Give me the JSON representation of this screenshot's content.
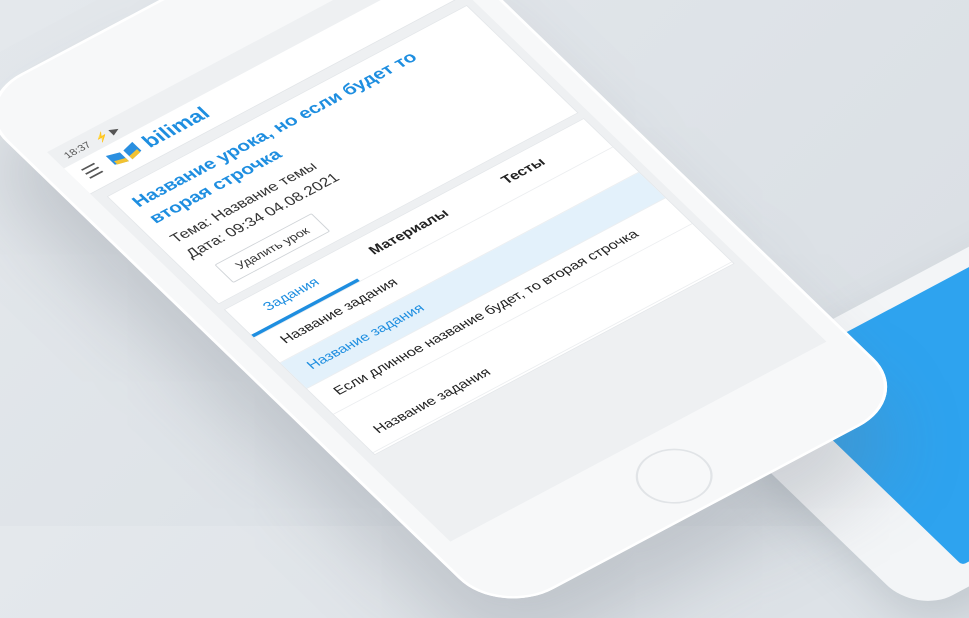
{
  "status_bar": {
    "time": "18:37",
    "icons": "⚡ ▶"
  },
  "app": {
    "brand": "bilimal",
    "menu_icon": "hamburger-icon"
  },
  "lesson": {
    "title": "Название урока, но если будет то вторая строчка",
    "topic": "Тема: Название темы",
    "date": "Дата: 09:34 04.08.2021",
    "delete_label": "Удалить урок"
  },
  "tabs": [
    {
      "label": "Задания"
    },
    {
      "label": "Материалы"
    },
    {
      "label": "Тесты"
    }
  ],
  "tasks": [
    {
      "label": "Название задания"
    },
    {
      "label": "Название задания"
    },
    {
      "label": "Если длинное название будет, то вторая строчка"
    },
    {
      "label": "Название задания"
    }
  ],
  "colors": {
    "accent": "#1e8ee0",
    "selected_row": "#e3f1fb",
    "second_screen": "#2ea3ef"
  }
}
